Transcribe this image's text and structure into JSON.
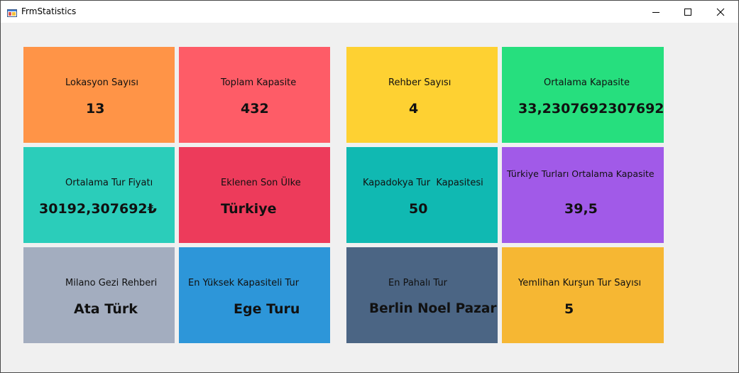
{
  "window": {
    "title": "FrmStatistics"
  },
  "colors": {
    "orange": "#ff9447",
    "red": "#fe5c67",
    "yellow": "#fed132",
    "green": "#26df7e",
    "teal": "#2bcdba",
    "crimson": "#ed3b5b",
    "darkteal": "#10b9b2",
    "purple": "#a15ae8",
    "gray": "#a3adbf",
    "blue": "#2d96d9",
    "slate": "#4b6584",
    "gold": "#f6b733"
  },
  "cards": [
    {
      "label": "Lokasyon Sayısı",
      "value": "13"
    },
    {
      "label": "Toplam Kapasite",
      "value": "432"
    },
    {
      "label": "Rehber Sayısı",
      "value": "4"
    },
    {
      "label": "Ortalama Kapasite",
      "value": "33,2307692307692"
    },
    {
      "label": "Ortalama Tur Fiyatı",
      "value": "30192,307692₺"
    },
    {
      "label": "Eklenen Son Ülke",
      "value": "Türkiye"
    },
    {
      "label": "Kapadokya Tur  Kapasitesi",
      "value": "50"
    },
    {
      "label": "Türkiye Turları Ortalama Kapasite",
      "value": "39,5"
    },
    {
      "label": "Milano Gezi Rehberi",
      "value": "Ata Türk"
    },
    {
      "label": "En Yüksek Kapasiteli Tur",
      "value": "Ege Turu"
    },
    {
      "label": "En Pahalı Tur",
      "value": "Berlin Noel Pazarı"
    },
    {
      "label": "Yemlihan Kurşun Tur Sayısı",
      "value": "5"
    }
  ]
}
